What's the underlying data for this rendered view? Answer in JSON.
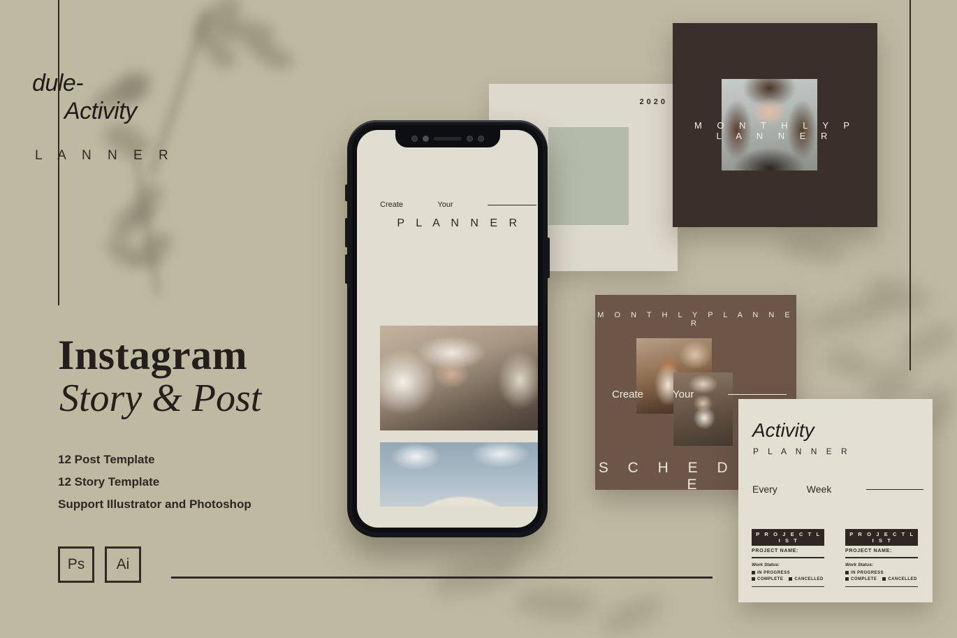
{
  "theme": {
    "background": "#bfb9a2",
    "ink": "#231f1c",
    "cream_card": "#ddd9cc",
    "green_block": "#b4bbaa",
    "dark_card": "#3b2f2b",
    "brown_card": "#6b5648",
    "white_card": "#e2dfd3"
  },
  "promo": {
    "title_line1": "Instagram",
    "title_line2": "Story & Post",
    "features": [
      "12 Post Template",
      "12 Story Template",
      "Support Illustrator and Photoshop"
    ],
    "badges": [
      {
        "label": "Ps",
        "name": "photoshop-badge"
      },
      {
        "label": "Ai",
        "name": "illustrator-badge"
      }
    ]
  },
  "phone_screen": {
    "word_create": "Create",
    "word_your": "Your",
    "title": "P L A N N E R",
    "photos": [
      {
        "name": "phone-photo-bathroom-portrait"
      },
      {
        "name": "phone-photo-sky-dome"
      }
    ]
  },
  "cream_card": {
    "year": "2020",
    "line1": "dule-",
    "line2": "Activity",
    "planner": "L A N N E R"
  },
  "dark_card": {
    "title": "M O N T H L Y      P L A N N E R",
    "photo_name": "model-portrait-photo"
  },
  "brown_card": {
    "header": "M O N T H L Y   P L A N N E R",
    "word_create": "Create",
    "word_your": "Your",
    "footer": "S C H E D U L E",
    "photos": [
      {
        "name": "iced-coffee-photo"
      },
      {
        "name": "woman-with-cup-photo"
      }
    ]
  },
  "activity_card": {
    "title": "Activity",
    "subtitle": "P L A N N E R",
    "word_every": "Every",
    "word_week": "Week",
    "project_columns": [
      {
        "bar": "P R O J E C T   L I S T",
        "name_label": "PROJECT NAME:",
        "status_label": "Work Status:",
        "options": [
          "IN PROGRESS",
          "COMPLETE",
          "CANCELLED"
        ]
      },
      {
        "bar": "P R O J E C T   L I S T",
        "name_label": "PROJECT NAME:",
        "status_label": "Work Status:",
        "options": [
          "IN PROGRESS",
          "COMPLETE",
          "CANCELLED"
        ]
      }
    ]
  }
}
